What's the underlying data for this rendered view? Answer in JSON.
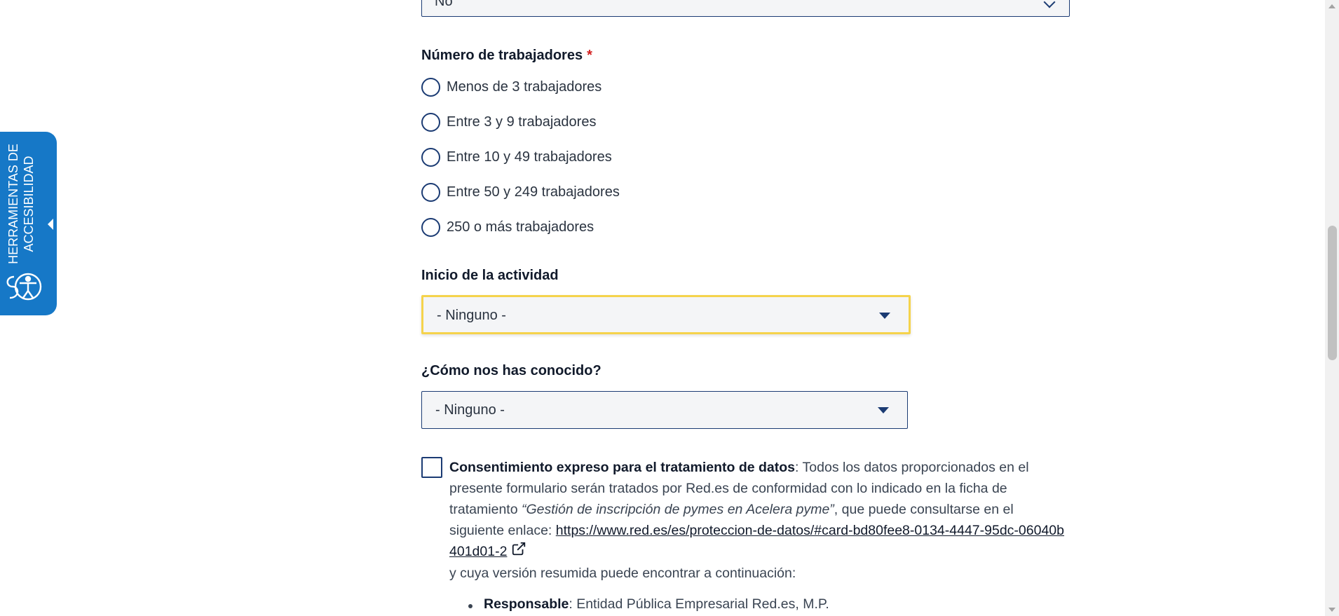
{
  "top_select": {
    "value": "No"
  },
  "workers": {
    "label": "Número de trabajadores",
    "required_mark": "*",
    "options": [
      "Menos de 3 trabajadores",
      "Entre 3 y 9 trabajadores",
      "Entre 10 y 49 trabajadores",
      "Entre 50 y 249 trabajadores",
      "250 o más trabajadores"
    ]
  },
  "activity_start": {
    "label": "Inicio de la actividad",
    "value": "- Ninguno -"
  },
  "how_known": {
    "label": "¿Cómo nos has conocido?",
    "value": "- Ninguno -"
  },
  "consent": {
    "title": "Consentimiento expreso para el tratamiento de datos",
    "text_1": ": Todos los datos proporcionados en el presente formulario serán tratados por Red.es de conformidad con lo indicado en la ficha de tratamiento ",
    "quote": "“Gestión de inscripción de pymes en Acelera pyme”",
    "text_2": ", que puede consultarse en el siguiente enlace: ",
    "link": "https://www.red.es/es/proteccion-de-datos/#card-bd80fee8-0134-4447-95dc-06040b401d01-2",
    "text_3": "y cuya versión resumida puede encontrar a continuación:"
  },
  "summary": [
    {
      "term": "Responsable",
      "value": ": Entidad Pública Empresarial Red.es, M.P."
    }
  ],
  "accessibility": {
    "line1": "HERRAMIENTAS DE",
    "line2": "ACCESIBILIDAD"
  },
  "colors": {
    "brand": "#1678c7",
    "focus": "#f5d34c",
    "border": "#1b3b73",
    "required": "#d32020"
  }
}
